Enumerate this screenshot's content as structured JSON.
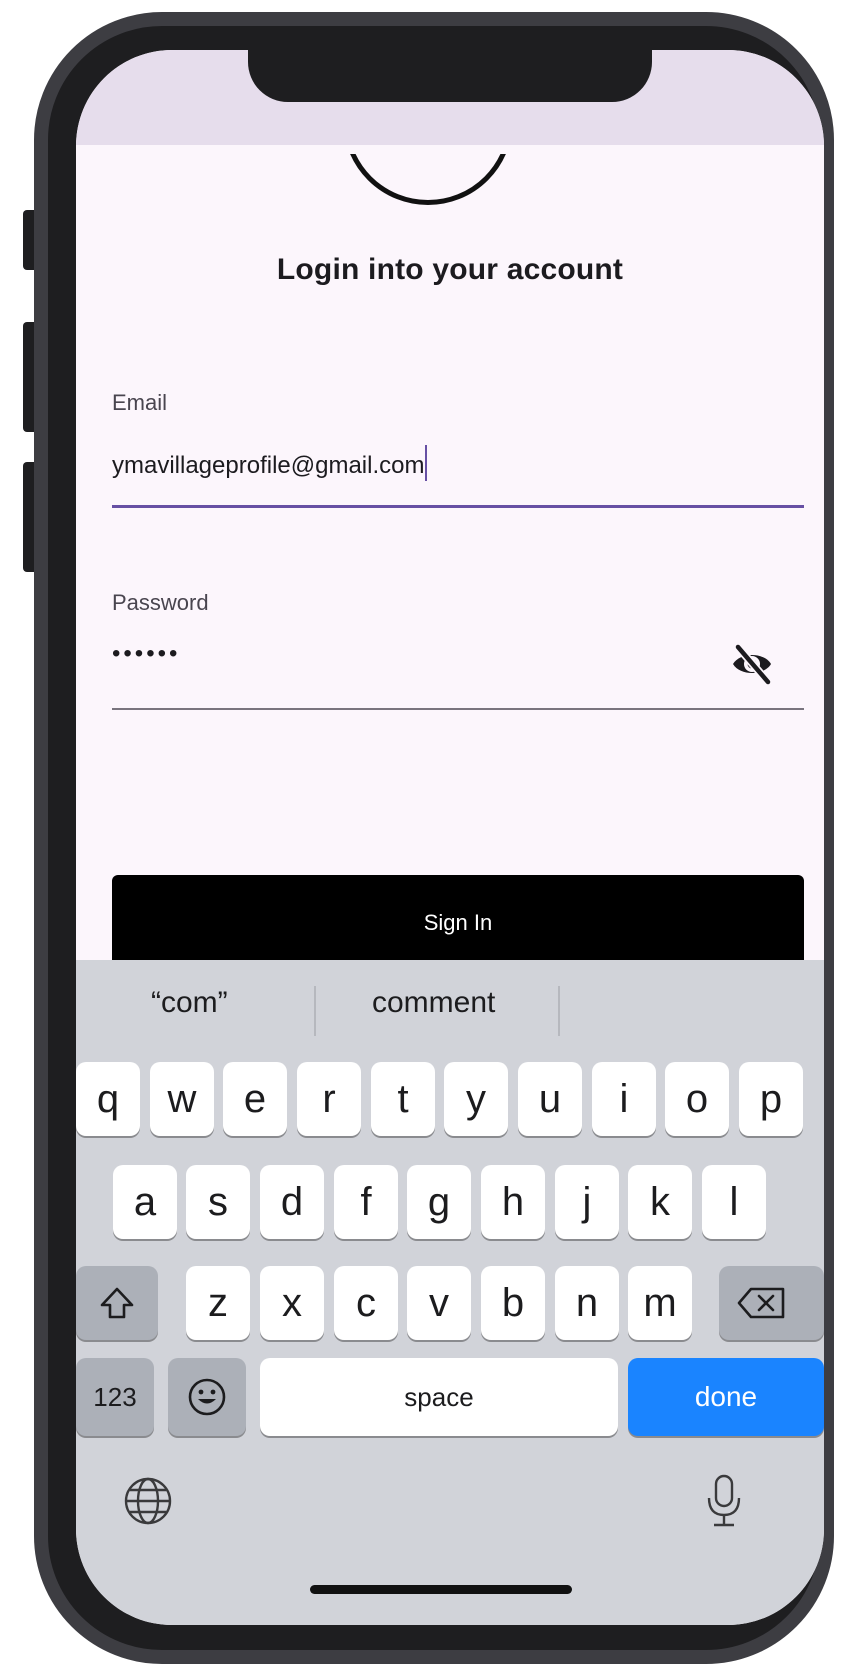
{
  "header": {
    "title": "Login into your account"
  },
  "email": {
    "label": "Email",
    "value": "ymavillageprofile@gmail.com"
  },
  "password": {
    "label": "Password",
    "masked_value": "••••••",
    "toggle_icon": "eye-slash-icon"
  },
  "signin": {
    "label": "Sign In"
  },
  "keyboard": {
    "suggestions": [
      "“com”",
      "comment"
    ],
    "row1": [
      "q",
      "w",
      "e",
      "r",
      "t",
      "y",
      "u",
      "i",
      "o",
      "p"
    ],
    "row2": [
      "a",
      "s",
      "d",
      "f",
      "g",
      "h",
      "j",
      "k",
      "l"
    ],
    "row3": [
      "z",
      "x",
      "c",
      "v",
      "b",
      "n",
      "m"
    ],
    "numbers_label": "123",
    "space_label": "space",
    "done_label": "done",
    "icons": [
      "shift-icon",
      "backspace-icon",
      "emoji-icon",
      "globe-icon",
      "microphone-icon"
    ]
  },
  "colors": {
    "accent": "#6750a4",
    "done_key": "#1a84ff",
    "app_bar": "#e6ddec",
    "background": "#fcf6fc",
    "keyboard_bg": "#d1d3d9"
  }
}
